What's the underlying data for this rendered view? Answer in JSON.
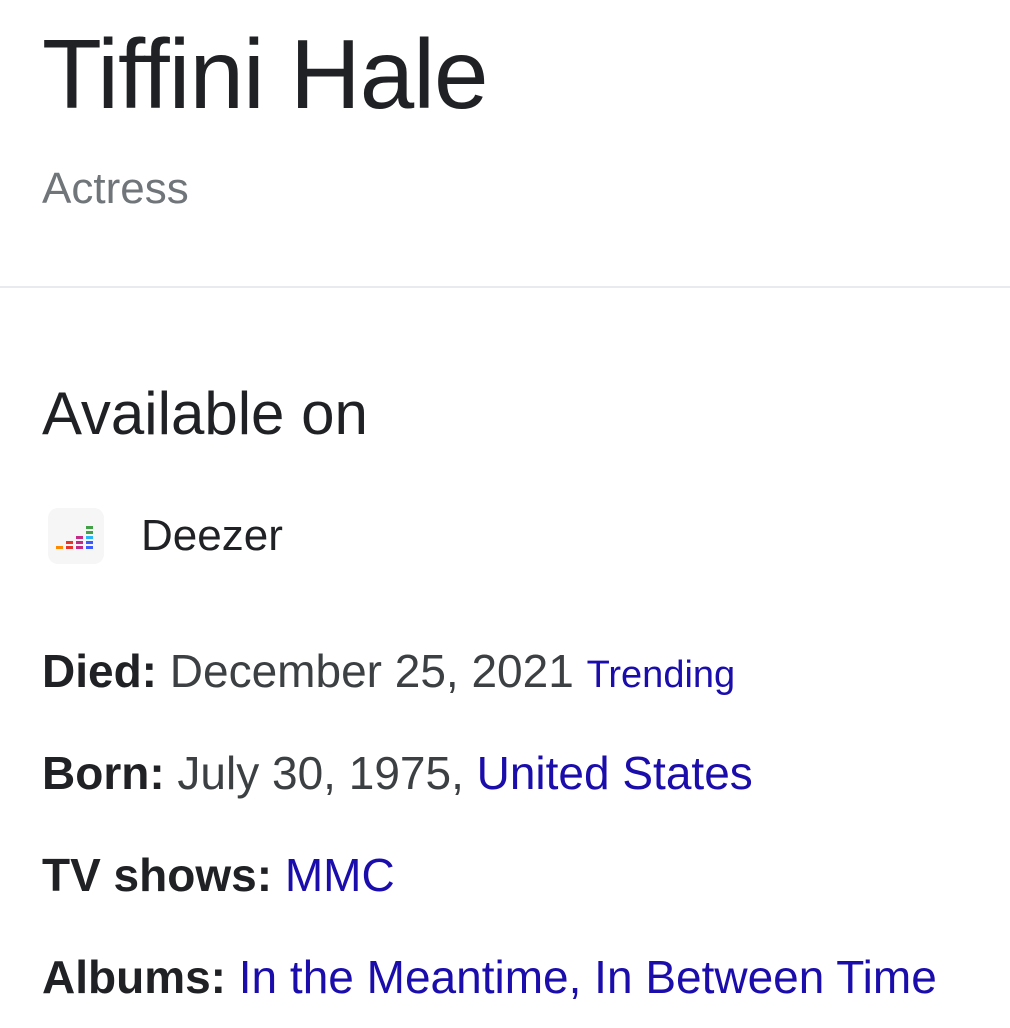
{
  "header": {
    "title": "Tiffini Hale",
    "subtitle": "Actress"
  },
  "available_on": {
    "heading": "Available on",
    "providers": [
      {
        "name": "Deezer",
        "icon": "deezer-icon"
      }
    ]
  },
  "facts": {
    "died": {
      "label": "Died:",
      "value": "December 25, 2021",
      "badge": "Trending"
    },
    "born": {
      "label": "Born:",
      "value": "July 30, 1975, ",
      "place": "United States"
    },
    "tv_shows": {
      "label": "TV shows:",
      "value": "MMC"
    },
    "albums": {
      "label": "Albums:",
      "value": "In the Meantime, In Between Time"
    }
  },
  "colors": {
    "link": "#1a0dab",
    "text": "#202124",
    "secondary_text": "#70757a",
    "divider": "#e8eaed"
  }
}
